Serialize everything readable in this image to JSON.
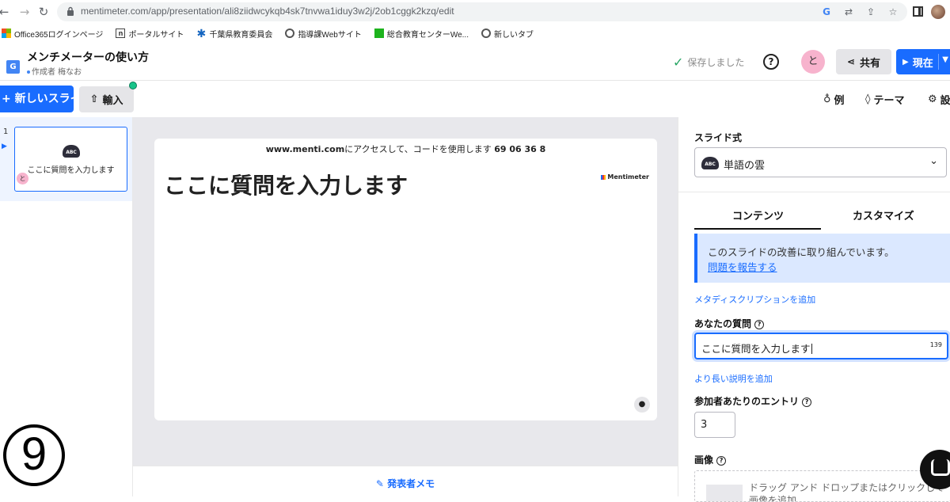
{
  "browser": {
    "url": "mentimeter.com/app/presentation/ali8ziidwcykqb4sk7tnvwa1iduy3w2j/2ob1cggk2kzq/edit",
    "bookmarks": [
      "Office365ログインページ",
      "ポータルサイト",
      "千葉県教育委員会",
      "指導課Webサイト",
      "総合教育センターWe...",
      "新しいタブ"
    ]
  },
  "header": {
    "title": "メンチメーターの使い方",
    "author": "作成者 梅なお",
    "save_status": "保存しました",
    "help": "?",
    "avatar_initial": "と",
    "share_label": "共有",
    "present_label": "現在"
  },
  "toolbar": {
    "new_slide_label": "+ 新しいスライド",
    "import_label": "輸入",
    "examples_label": "例",
    "themes_label": "テーマ",
    "settings_label": "設定"
  },
  "slides": [
    {
      "number": "1",
      "icon_text": "ABC",
      "title": "ここに質問を入力します",
      "avatar": "と"
    }
  ],
  "canvas": {
    "join_prefix": "www.menti.com",
    "join_middle": "にアクセスして、コードを使用します",
    "join_code": "69 06 36 8",
    "heading": "ここに質問を入力します",
    "brand": "Mentimeter"
  },
  "presenter_notes_label": "発表者メモ",
  "overlay_number": "9",
  "panel": {
    "slide_type_label": "スライド式",
    "slide_type_value": "単語の雲",
    "slide_type_icon_text": "ABC",
    "tabs": [
      "コンテンツ",
      "カスタマイズ"
    ],
    "notice_text": "このスライドの改善に取り組んでいます。",
    "notice_link": "問題を報告する",
    "meta_link": "メタディスクリプションを追加",
    "question_label": "あなたの質問",
    "question_value": "ここに質問を入力します",
    "question_count": "139",
    "long_desc_link": "より長い説明を追加",
    "entries_label": "参加者あたりのエントリ",
    "entries_value": "3",
    "image_label": "画像",
    "dropzone_text": "ドラッグ アンド ドロップまたはクリックして画像を追加"
  },
  "colors": {
    "accent": "#196cff",
    "avatar": "#f7b3cd",
    "notice_bg": "#dbe8ff"
  }
}
